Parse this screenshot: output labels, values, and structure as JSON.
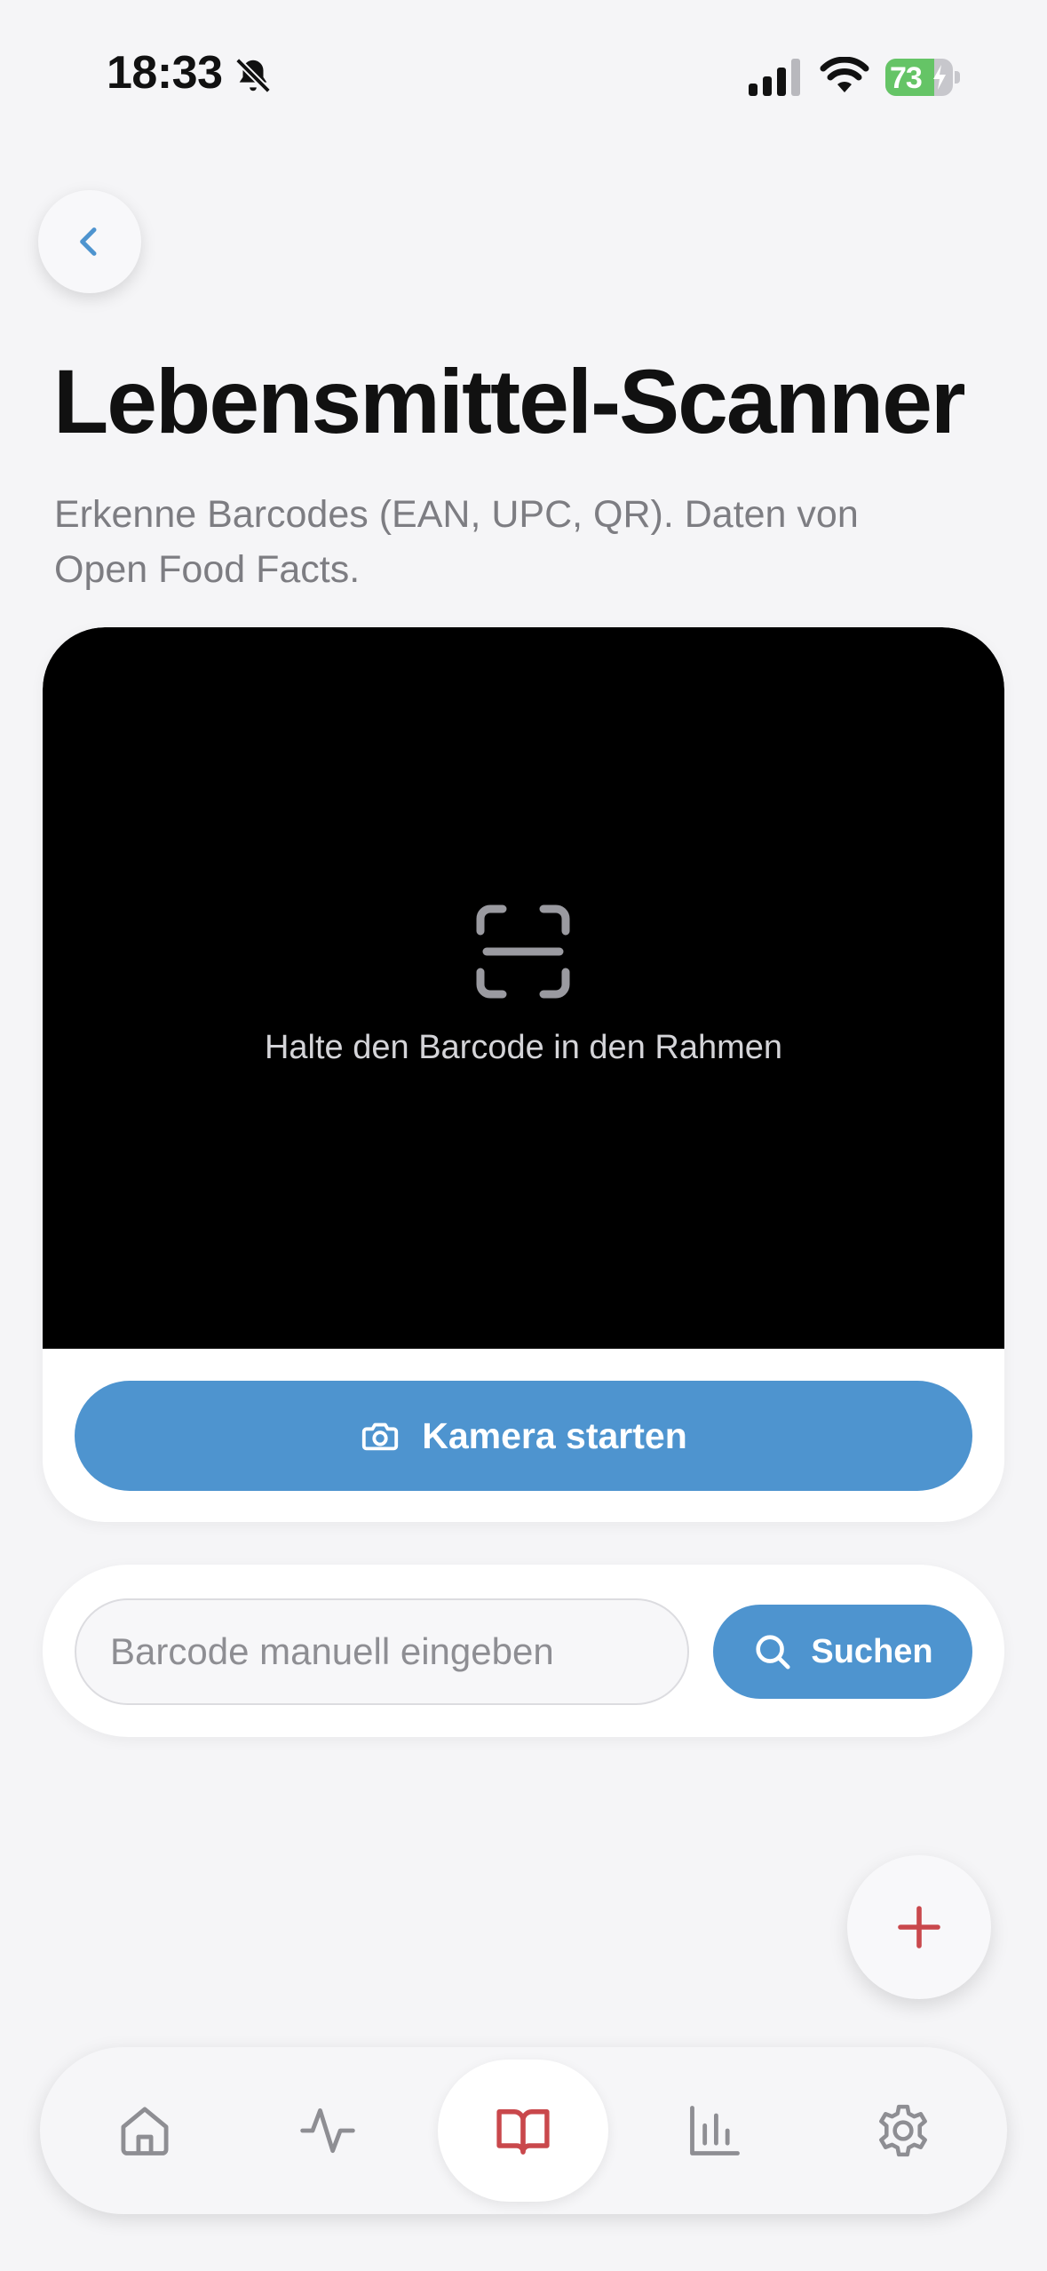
{
  "status_bar": {
    "time": "18:33",
    "battery_percent": "73",
    "battery_level": 0.73
  },
  "header": {
    "title": "Lebensmittel-Scanner",
    "subtitle": "Erkenne Barcodes (EAN, UPC, QR). Daten von Open Food Facts."
  },
  "scanner": {
    "hint": "Halte den Barcode in den Rahmen",
    "start_label": "Kamera starten"
  },
  "manual_entry": {
    "placeholder": "Barcode manuell eingeben",
    "value": "",
    "search_label": "Suchen"
  },
  "tab_bar": {
    "tabs": [
      {
        "icon": "home-icon",
        "active": false
      },
      {
        "icon": "activity-icon",
        "active": false
      },
      {
        "icon": "book-icon",
        "active": true
      },
      {
        "icon": "bar-chart-icon",
        "active": false
      },
      {
        "icon": "gear-icon",
        "active": false
      }
    ]
  },
  "colors": {
    "accent_blue": "#4e94cf",
    "accent_red": "#c9484c",
    "battery_green": "#65c466",
    "background": "#f5f5f7"
  }
}
